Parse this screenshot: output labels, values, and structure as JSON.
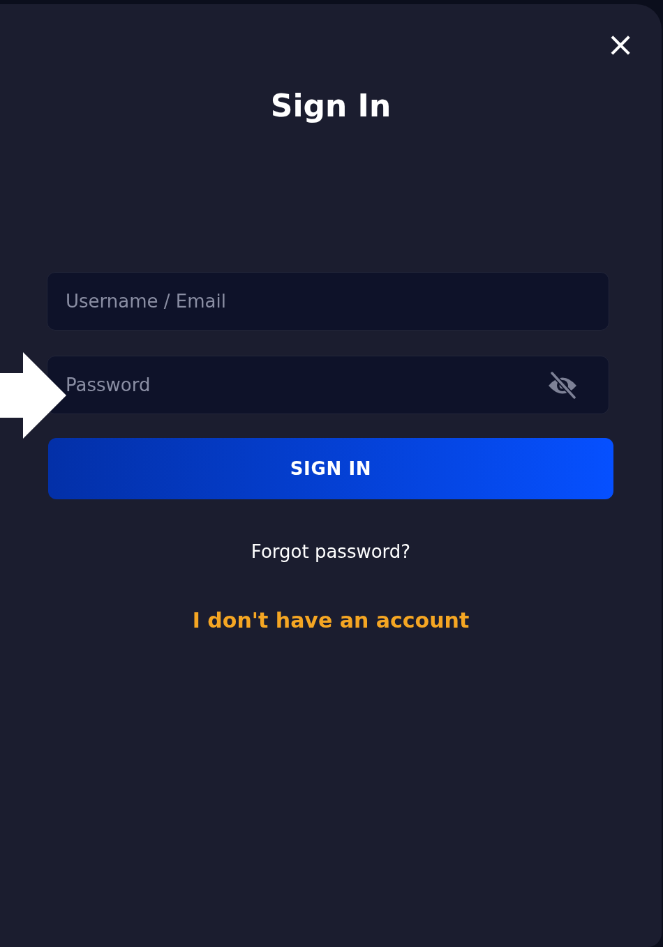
{
  "dialog": {
    "title": "Sign In",
    "close": "×"
  },
  "fields": [
    {
      "kind": "text",
      "placeholder": "Username / Email"
    },
    {
      "kind": "password",
      "placeholder": "Password"
    }
  ],
  "submit": "SIGN IN",
  "forgot_link": "Forgot password?",
  "register_link": "I don't have an account"
}
